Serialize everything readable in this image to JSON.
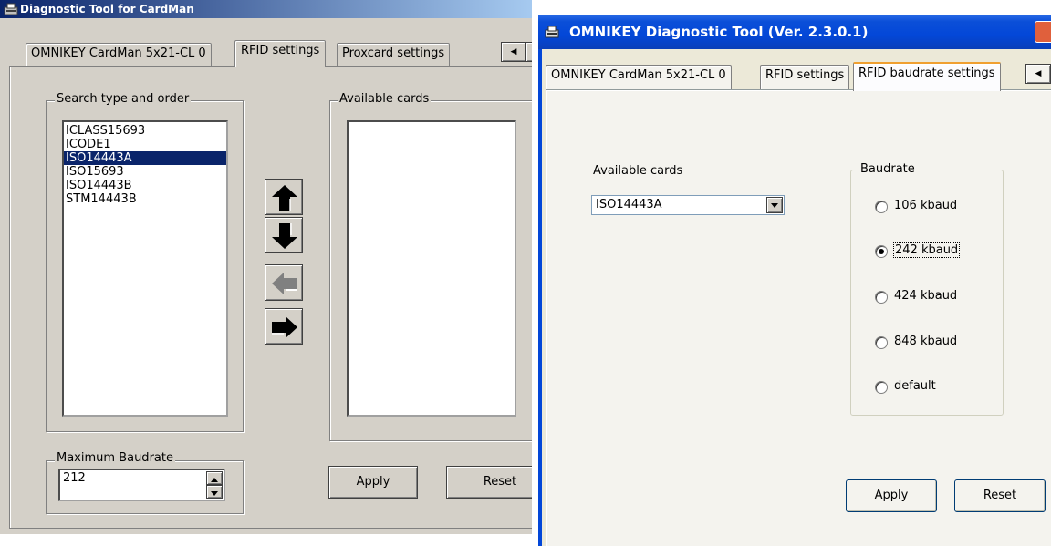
{
  "left_window": {
    "title": "Diagnostic Tool for CardMan",
    "tabs": [
      "OMNIKEY CardMan 5x21-CL 0",
      "RFID settings",
      "Proxcard settings"
    ],
    "active_tab": "RFID settings",
    "search_group": {
      "legend": "Search type and order",
      "items": [
        "ICLASS15693",
        "ICODE1",
        "ISO14443A",
        "ISO15693",
        "ISO14443B",
        "STM14443B"
      ],
      "selected": "ISO14443A"
    },
    "available_group": {
      "legend": "Available cards"
    },
    "move_buttons": [
      "arrow-up-icon",
      "arrow-down-icon",
      "arrow-left-icon",
      "arrow-right-icon"
    ],
    "max_baud": {
      "legend": "Maximum Baudrate",
      "value": "212"
    },
    "apply_label": "Apply",
    "reset_label": "Reset"
  },
  "right_window": {
    "title": "OMNIKEY Diagnostic Tool (Ver. 2.3.0.1)",
    "tabs": [
      "OMNIKEY CardMan 5x21-CL 0",
      "RFID settings",
      "RFID baudrate settings"
    ],
    "active_tab": "RFID baudrate settings",
    "available_cards_label": "Available cards",
    "selected_card": "ISO14443A",
    "baudrate": {
      "legend": "Baudrate",
      "options": [
        "106 kbaud",
        "242 kbaud",
        "424 kbaud",
        "848 kbaud",
        "default"
      ],
      "selected": "242 kbaud"
    },
    "apply_label": "Apply",
    "reset_label": "Reset"
  },
  "colors": {
    "selection": "#0a246a",
    "face": "#d4d0c8",
    "xp_title": "#0347d8"
  }
}
